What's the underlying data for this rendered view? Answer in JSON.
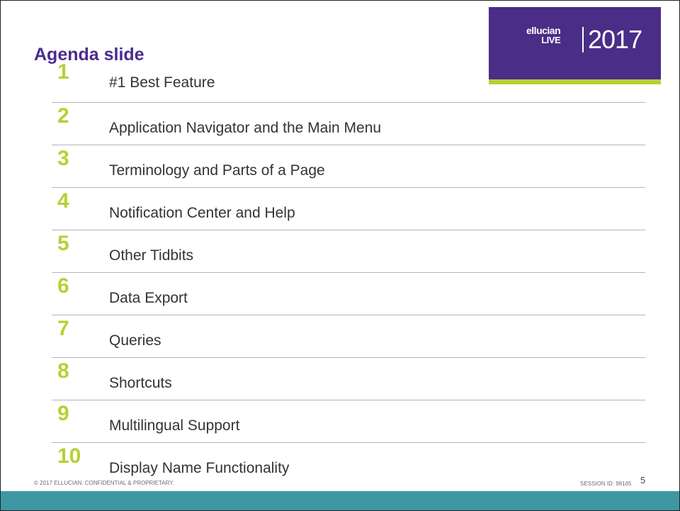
{
  "slide": {
    "title": "Agenda slide",
    "logo": {
      "brand": "ellucian",
      "sub": "LIVE",
      "year": "2017"
    },
    "agenda": [
      {
        "number": "1",
        "label": "#1 Best Feature"
      },
      {
        "number": "2",
        "label": "Application Navigator and the Main Menu"
      },
      {
        "number": "3",
        "label": "Terminology and Parts of a Page"
      },
      {
        "number": "4",
        "label": "Notification Center and Help"
      },
      {
        "number": "5",
        "label": "Other Tidbits"
      },
      {
        "number": "6",
        "label": "Data Export"
      },
      {
        "number": "7",
        "label": "Queries"
      },
      {
        "number": "8",
        "label": "Shortcuts"
      },
      {
        "number": "9",
        "label": "Multilingual Support"
      },
      {
        "number": "10",
        "label": "Display Name Functionality"
      }
    ],
    "footer": {
      "copyright": "© 2017 ELLUCIAN. CONFIDENTIAL & PROPRIETARY.",
      "session": "SESSION ID: 98165",
      "page_number": "5"
    }
  },
  "colors": {
    "title": "#4a2c8f",
    "logo_background": "#4a2d86",
    "accent_green": "#b6d134",
    "bottom_bar": "#3d98a4"
  }
}
